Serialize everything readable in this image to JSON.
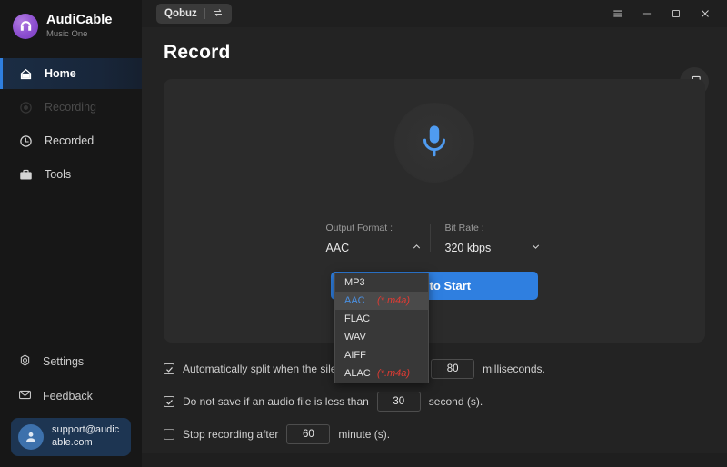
{
  "app": {
    "brand_name": "AudiCable",
    "brand_sub": "Music One",
    "logo_icon": "headphones-circle-icon"
  },
  "sidebar": {
    "items": [
      {
        "label": "Home",
        "icon": "home-icon",
        "state": "active"
      },
      {
        "label": "Recording",
        "icon": "record-dot-icon",
        "state": "disabled"
      },
      {
        "label": "Recorded",
        "icon": "clock-icon",
        "state": "normal"
      },
      {
        "label": "Tools",
        "icon": "toolbox-icon",
        "state": "normal"
      }
    ],
    "bottom_items": [
      {
        "label": "Settings",
        "icon": "gear-icon"
      },
      {
        "label": "Feedback",
        "icon": "envelope-icon"
      }
    ],
    "account": {
      "email": "support@audicable.com",
      "avatar_icon": "user-avatar-icon"
    }
  },
  "titlebar": {
    "source_label": "Qobuz",
    "switch_icon": "swap-arrows-icon",
    "menu_icon": "hamburger-menu-icon",
    "minimize_icon": "minimize-icon",
    "maximize_icon": "maximize-icon",
    "close_icon": "close-icon"
  },
  "main": {
    "page_title": "Record",
    "float_button_icon": "add-music-window-icon",
    "mic_icon": "microphone-icon",
    "output_format": {
      "label": "Output Format :",
      "value": "AAC",
      "chevron": "chevron-up-icon"
    },
    "bit_rate": {
      "label": "Bit Rate :",
      "value": "320 kbps",
      "chevron": "chevron-down-icon"
    },
    "start_button": "Click to Start"
  },
  "dropdown": {
    "open": true,
    "options": [
      {
        "name": "MP3",
        "ext": "",
        "selected": false
      },
      {
        "name": "AAC",
        "ext": "(*.m4a)",
        "selected": true
      },
      {
        "name": "FLAC",
        "ext": "",
        "selected": false
      },
      {
        "name": "WAV",
        "ext": "",
        "selected": false
      },
      {
        "name": "AIFF",
        "ext": "",
        "selected": false
      },
      {
        "name": "ALAC",
        "ext": "(*.m4a)",
        "selected": false
      }
    ]
  },
  "options": [
    {
      "checked": true,
      "text_before": "Automatically split when the silence is longer than",
      "value": "80",
      "text_after": "milliseconds."
    },
    {
      "checked": true,
      "text_before": "Do not save if an audio file is less than",
      "value": "30",
      "text_after": "second (s)."
    },
    {
      "checked": false,
      "text_before": "Stop recording after",
      "value": "60",
      "text_after": "minute (s)."
    }
  ],
  "colors": {
    "accent_blue": "#2f7fe0",
    "selected_text_blue": "#4a90e2",
    "extension_red": "#e03b33",
    "brand_purple": "#8d4fd0",
    "window_bg": "#232323",
    "sidebar_bg": "#171717",
    "card_bg": "#2b2b2b"
  }
}
